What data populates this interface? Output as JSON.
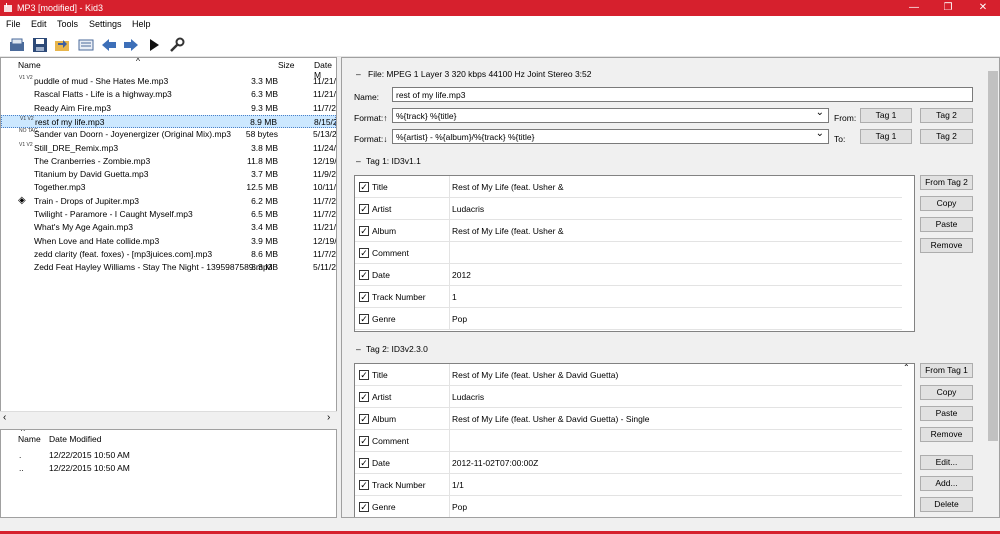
{
  "window": {
    "title": "MP3 [modified] - Kid3",
    "minimize": "—",
    "maximize": "❐",
    "close": "✕"
  },
  "menu": [
    "File",
    "Edit",
    "Tools",
    "Settings",
    "Help"
  ],
  "toolbar": [
    "open-icon",
    "save-icon",
    "revert-icon",
    "playlist-icon",
    "previous-icon",
    "next-icon",
    "play-icon",
    "settings-icon"
  ],
  "filelist": {
    "headers": {
      "name": "Name",
      "size": "Size",
      "date": "Date M"
    },
    "sort_arrow": "^",
    "files": [
      {
        "icon": "V1 V2",
        "name": "puddle of mud - She Hates Me.mp3",
        "size": "3.3 MB",
        "date": "11/21/"
      },
      {
        "icon": "",
        "name": "Rascal Flatts - Life is a highway.mp3",
        "size": "6.3 MB",
        "date": "11/21/"
      },
      {
        "icon": "",
        "name": "Ready Aim Fire.mp3",
        "size": "9.3 MB",
        "date": "11/7/2"
      },
      {
        "icon": "V1 V2",
        "name": "rest of my life.mp3",
        "size": "8.9 MB",
        "date": "8/15/2",
        "selected": true
      },
      {
        "icon": "NO TAG",
        "name": "Sander van Doorn - Joyenergizer (Original Mix).mp3",
        "size": "58 bytes",
        "date": "5/13/2"
      },
      {
        "icon": "V1 V2",
        "name": "Still_DRE_Remix.mp3",
        "size": "3.8 MB",
        "date": "11/24/"
      },
      {
        "icon": "",
        "name": "The Cranberries - Zombie.mp3",
        "size": "11.8 MB",
        "date": "12/19/"
      },
      {
        "icon": "",
        "name": "Titanium by David Guetta.mp3",
        "size": "3.7 MB",
        "date": "11/9/2"
      },
      {
        "icon": "",
        "name": "Together.mp3",
        "size": "12.5 MB",
        "date": "10/11/"
      },
      {
        "icon": "diamond",
        "name": "Train - Drops of Jupiter.mp3",
        "size": "6.2 MB",
        "date": "11/7/2"
      },
      {
        "icon": "",
        "name": "Twilight - Paramore - I Caught Myself.mp3",
        "size": "6.5 MB",
        "date": "11/7/2"
      },
      {
        "icon": "",
        "name": "What's My Age Again.mp3",
        "size": "3.4 MB",
        "date": "11/21/"
      },
      {
        "icon": "",
        "name": "When Love and Hate collide.mp3",
        "size": "3.9 MB",
        "date": "12/19/"
      },
      {
        "icon": "",
        "name": "zedd clarity (feat. foxes) - [mp3juices.com].mp3",
        "size": "8.6 MB",
        "date": "11/7/2"
      },
      {
        "icon": "",
        "name": "Zedd Feat Hayley Williams - Stay The Night - 1395987589.mp3",
        "size": "3.3 MB",
        "date": "5/11/2"
      }
    ]
  },
  "dirlist": {
    "headers": {
      "name": "Name",
      "date": "Date Modified"
    },
    "rows": [
      {
        "name": ".",
        "date": "12/22/2015 10:50 AM"
      },
      {
        "name": "..",
        "date": "12/22/2015 10:50 AM"
      }
    ]
  },
  "file_info": "File: MPEG 1 Layer 3 320 kbps 44100 Hz Joint Stereo 3:52",
  "name_label": "Name:",
  "name_value": "rest of my life.mp3",
  "format_up_label": "Format:↑",
  "format_up_value": "%{track} %{title}",
  "from_label": "From:",
  "format_down_label": "Format:↓",
  "format_down_value": "%{artist} - %{album}/%{track} %{title}",
  "to_label": "To:",
  "tag1_btn": "Tag 1",
  "tag2_btn": "Tag 2",
  "tag1": {
    "title": "Tag 1: ID3v1.1",
    "fields": [
      {
        "name": "Title",
        "value": "Rest of My Life (feat. Usher &"
      },
      {
        "name": "Artist",
        "value": "Ludacris"
      },
      {
        "name": "Album",
        "value": "Rest of My Life (feat. Usher &"
      },
      {
        "name": "Comment",
        "value": ""
      },
      {
        "name": "Date",
        "value": "2012"
      },
      {
        "name": "Track Number",
        "value": "1"
      },
      {
        "name": "Genre",
        "value": "Pop"
      }
    ],
    "buttons": [
      "From Tag 2",
      "Copy",
      "Paste",
      "Remove"
    ]
  },
  "tag2": {
    "title": "Tag 2: ID3v2.3.0",
    "fields": [
      {
        "name": "Title",
        "value": "Rest of My Life (feat. Usher & David Guetta)"
      },
      {
        "name": "Artist",
        "value": "Ludacris"
      },
      {
        "name": "Album",
        "value": "Rest of My Life (feat. Usher & David Guetta) - Single"
      },
      {
        "name": "Comment",
        "value": ""
      },
      {
        "name": "Date",
        "value": "2012-11-02T07:00:00Z"
      },
      {
        "name": "Track Number",
        "value": "1/1"
      },
      {
        "name": "Genre",
        "value": "Pop"
      }
    ],
    "buttons": [
      "From Tag 1",
      "Copy",
      "Paste",
      "Remove",
      "Edit...",
      "Add...",
      "Delete"
    ]
  },
  "colors": {
    "titlebar": "#d6202d",
    "selection": "#cce8ff"
  }
}
